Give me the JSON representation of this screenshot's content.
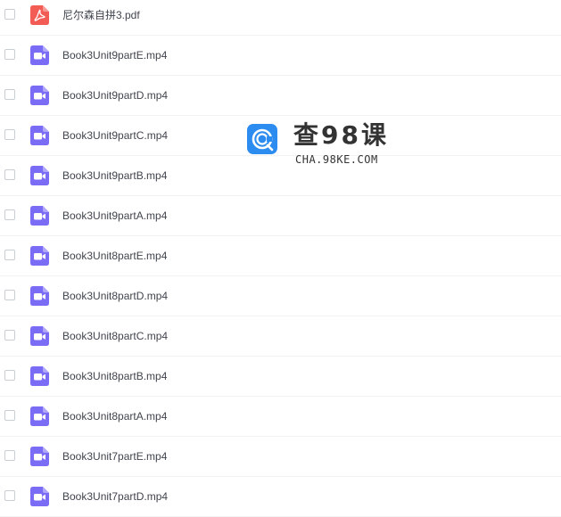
{
  "files": [
    {
      "name": "尼尔森自拼3.pdf",
      "type": "pdf",
      "icon": "pdf-file-icon"
    },
    {
      "name": "Book3Unit9partE.mp4",
      "type": "video",
      "icon": "video-file-icon"
    },
    {
      "name": "Book3Unit9partD.mp4",
      "type": "video",
      "icon": "video-file-icon"
    },
    {
      "name": "Book3Unit9partC.mp4",
      "type": "video",
      "icon": "video-file-icon"
    },
    {
      "name": "Book3Unit9partB.mp4",
      "type": "video",
      "icon": "video-file-icon"
    },
    {
      "name": "Book3Unit9partA.mp4",
      "type": "video",
      "icon": "video-file-icon"
    },
    {
      "name": "Book3Unit8partE.mp4",
      "type": "video",
      "icon": "video-file-icon"
    },
    {
      "name": "Book3Unit8partD.mp4",
      "type": "video",
      "icon": "video-file-icon"
    },
    {
      "name": "Book3Unit8partC.mp4",
      "type": "video",
      "icon": "video-file-icon"
    },
    {
      "name": "Book3Unit8partB.mp4",
      "type": "video",
      "icon": "video-file-icon"
    },
    {
      "name": "Book3Unit8partA.mp4",
      "type": "video",
      "icon": "video-file-icon"
    },
    {
      "name": "Book3Unit7partE.mp4",
      "type": "video",
      "icon": "video-file-icon"
    },
    {
      "name": "Book3Unit7partD.mp4",
      "type": "video",
      "icon": "video-file-icon"
    }
  ],
  "watermark": {
    "title": "查98课",
    "subtitle": "CHA.98KE.COM",
    "icon": "cha98ke-logo-icon"
  },
  "colors": {
    "pdf_icon": "#f25c54",
    "video_icon": "#7b6cf5",
    "logo": "#2d8cf0",
    "text": "#40444d",
    "divider": "#f1f2f4"
  }
}
